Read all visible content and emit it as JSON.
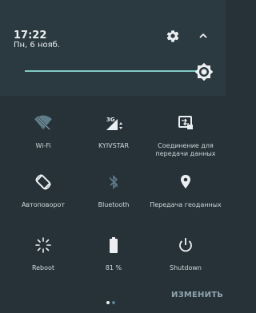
{
  "status": {
    "time": "17:22",
    "date": "Пн, 6 нояб."
  },
  "header": {
    "settings_icon": "gear-icon",
    "collapse_icon": "chevron-up-icon"
  },
  "brightness": {
    "level_fraction": 0.97,
    "icon": "brightness-icon"
  },
  "tiles": [
    {
      "label": "Wi-Fi",
      "icon": "wifi-off-icon"
    },
    {
      "label": "KYIVSTAR",
      "icon": "cell-signal-icon",
      "network": "3G"
    },
    {
      "label": "Соединение для передачи данных",
      "icon": "data-connection-icon"
    },
    {
      "label": "Автоповорот",
      "icon": "auto-rotate-icon"
    },
    {
      "label": "Bluetooth",
      "icon": "bluetooth-icon"
    },
    {
      "label": "Передача геоданных",
      "icon": "location-icon"
    },
    {
      "label": "Reboot",
      "icon": "reboot-icon"
    },
    {
      "label": "81 %",
      "icon": "battery-icon"
    },
    {
      "label": "Shutdown",
      "icon": "power-icon"
    }
  ],
  "footer": {
    "edit_label": "ИЗМЕНИТЬ",
    "page_indicator": "page 1 of 2"
  },
  "colors": {
    "background": "#263238",
    "accent": "#80cbc4",
    "text": "#eceff1",
    "muted": "#90a4ae"
  }
}
